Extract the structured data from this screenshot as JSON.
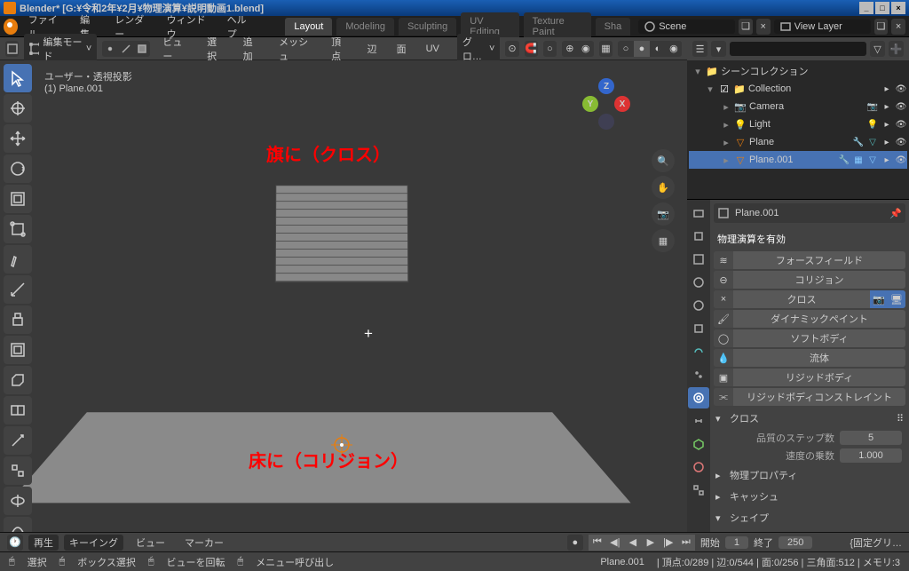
{
  "title": "Blender* [G:¥令和2年¥2月¥物理演算¥説明動画1.blend]",
  "topmenu": {
    "file": "ファイル",
    "edit": "編集",
    "render": "レンダー",
    "window": "ウィンドウ",
    "help": "ヘルプ"
  },
  "workspaces": {
    "layout": "Layout",
    "modeling": "Modeling",
    "sculpting": "Sculpting",
    "uv": "UV Editing",
    "texture": "Texture Paint",
    "sha": "Sha"
  },
  "scene": {
    "label": "Scene",
    "viewlayer": "View Layer"
  },
  "vpheader": {
    "mode": "編集モード",
    "view": "ビュー",
    "select": "選択",
    "add": "追加",
    "mesh": "メッシュ",
    "vertex": "頂点",
    "edge": "辺",
    "face": "面",
    "uv": "UV",
    "glo": "グロ…"
  },
  "overlay": {
    "l1": "ユーザー・透視投影",
    "l2": "(1) Plane.001"
  },
  "anno": {
    "cloth": "旗に（クロス）",
    "floor": "床に（コリジョン）"
  },
  "outliner": {
    "search_ph": "",
    "root": "シーンコレクション",
    "coll": "Collection",
    "camera": "Camera",
    "light": "Light",
    "plane": "Plane",
    "plane001": "Plane.001"
  },
  "props": {
    "obj": "Plane.001",
    "enable": "物理演算を有効",
    "buttons": {
      "force": "フォースフィールド",
      "collision": "コリジョン",
      "cloth": "クロス",
      "dynpaint": "ダイナミックペイント",
      "softbody": "ソフトボディ",
      "fluid": "流体",
      "rigid": "リジッドボディ",
      "rigidcon": "リジッドボディコンストレイント"
    },
    "cloth_h": "クロス",
    "quality": {
      "lbl": "品質のステップ数",
      "val": "5"
    },
    "speed": {
      "lbl": "速度の乗数",
      "val": "1.000"
    },
    "phys": "物理プロパティ",
    "cache": "キャッシュ",
    "shape": "シェイプ"
  },
  "timeline": {
    "play": "再生",
    "keying": "キーイング",
    "view": "ビュー",
    "marker": "マーカー",
    "start": "開始",
    "startval": "1",
    "end": "終了",
    "endval": "250"
  },
  "status": {
    "select": "選択",
    "box": "ボックス選択",
    "rotate": "ビューを回転",
    "menu": "メニュー呼び出し",
    "cut": "{固定グリ…",
    "obj": "Plane.001",
    "stats": "| 頂点:0/289 | 辺:0/544 | 面:0/256 | 三角面:512 | メモリ:3"
  }
}
